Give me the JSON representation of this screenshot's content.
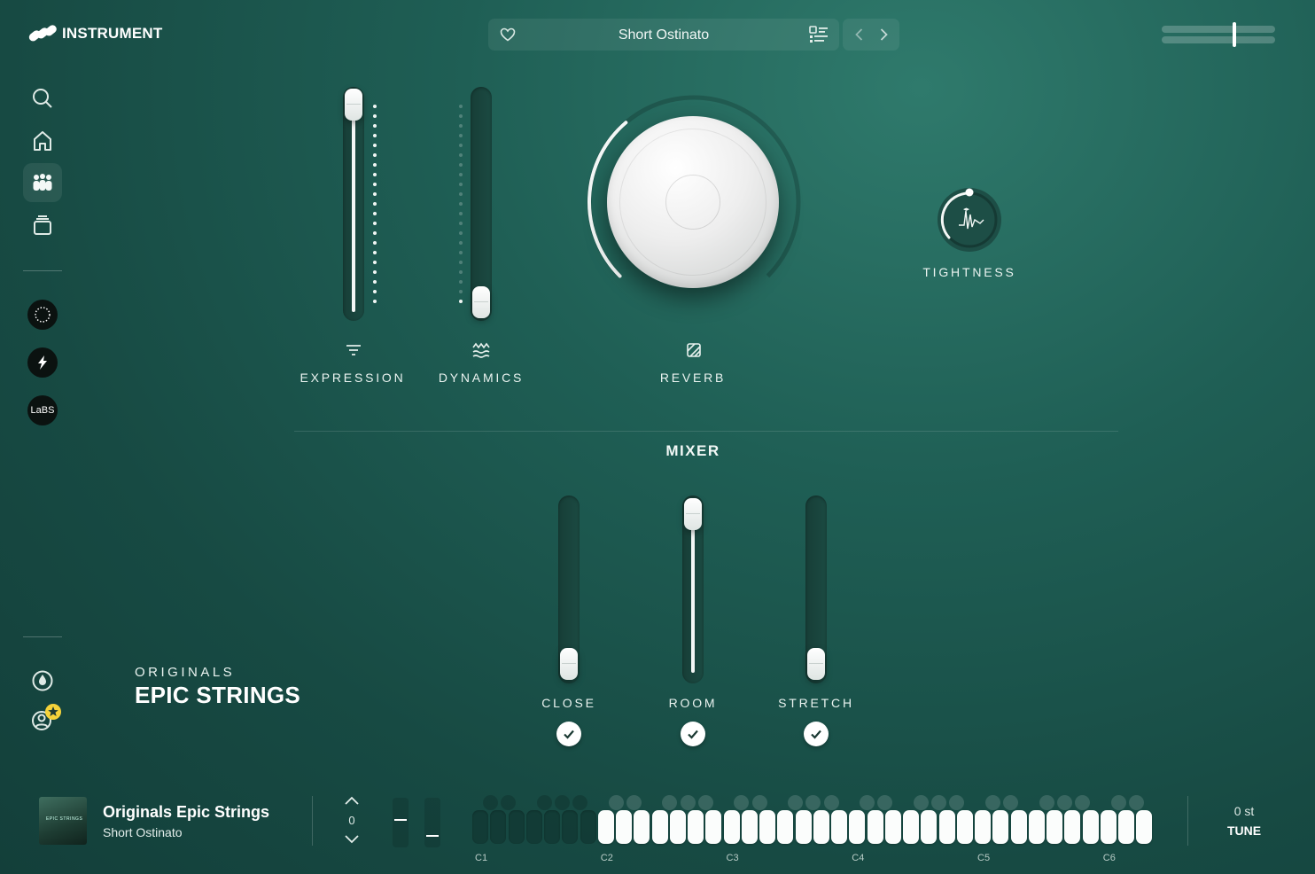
{
  "app": {
    "logo_text": "INSTRUMENT"
  },
  "preset": {
    "name": "Short Ostinato"
  },
  "icons": {
    "favorite": "heart-icon",
    "preset_list": "list-icon",
    "prev": "chevron-left-icon",
    "next": "chevron-right-icon"
  },
  "master_volume": {
    "level": 0.65
  },
  "sidebar": {
    "items": [
      {
        "name": "search",
        "icon": "search-icon"
      },
      {
        "name": "home",
        "icon": "home-icon"
      },
      {
        "name": "instruments",
        "icon": "people-icon",
        "active": true
      },
      {
        "name": "library",
        "icon": "stack-icon"
      }
    ],
    "brands": [
      {
        "name": "originals",
        "icon": "circle-brand-icon"
      },
      {
        "name": "spitfire",
        "icon": "spitfire-icon"
      },
      {
        "name": "labs",
        "label": "LaBS"
      }
    ],
    "bottom": [
      {
        "name": "drop",
        "icon": "drop-icon"
      },
      {
        "name": "account",
        "icon": "user-star-icon"
      }
    ]
  },
  "controls": {
    "expression": {
      "label": "EXPRESSION",
      "value": 0.92
    },
    "dynamics": {
      "label": "DYNAMICS",
      "value": 0.08
    },
    "reverb": {
      "label": "REVERB",
      "value": 0.35
    },
    "tightness": {
      "label": "TIGHTNESS",
      "value": 0.5
    }
  },
  "mixer": {
    "title": "MIXER",
    "channels": [
      {
        "label": "CLOSE",
        "value": 0.08,
        "enabled": true
      },
      {
        "label": "ROOM",
        "value": 0.92,
        "enabled": true
      },
      {
        "label": "STRETCH",
        "value": 0.08,
        "enabled": true
      }
    ]
  },
  "instrument": {
    "series": "ORIGINALS",
    "name": "EPIC STRINGS"
  },
  "footer": {
    "title": "Originals Epic Strings",
    "subtitle": "Short Ostinato",
    "thumb_text": "EPIC STRINGS",
    "octave": "0",
    "octave_labels": [
      "C1",
      "C2",
      "C3",
      "C4",
      "C5",
      "C6"
    ],
    "tune_value": "0 st",
    "tune_label": "TUNE"
  }
}
